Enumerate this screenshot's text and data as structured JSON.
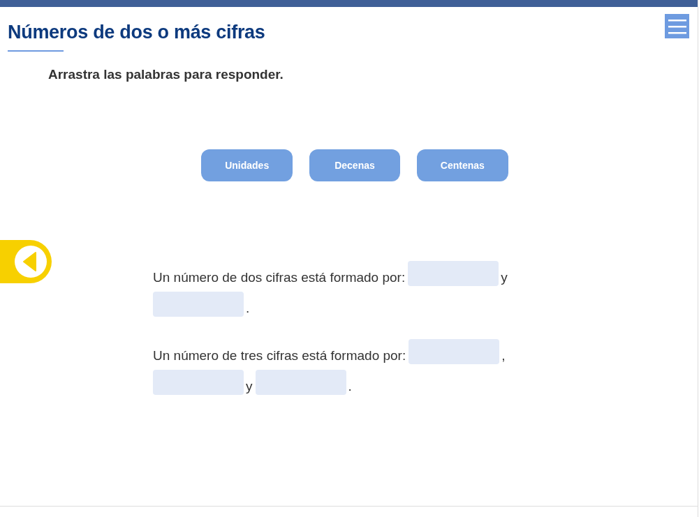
{
  "title": "Números de dos o más cifras",
  "instruction": "Arrastra las palabras para responder.",
  "words": [
    "Unidades",
    "Decenas",
    "Centenas"
  ],
  "sentences": [
    {
      "parts": [
        {
          "kind": "text",
          "text": "Un número de dos cifras está formado por:"
        },
        {
          "kind": "blank"
        },
        {
          "kind": "text",
          "text": "y"
        },
        {
          "kind": "blank"
        },
        {
          "kind": "text",
          "text": "."
        }
      ]
    },
    {
      "parts": [
        {
          "kind": "text",
          "text": "Un número de tres cifras está formado por:"
        },
        {
          "kind": "blank"
        },
        {
          "kind": "text",
          "text": ","
        },
        {
          "kind": "blank"
        },
        {
          "kind": "text",
          "text": "y"
        },
        {
          "kind": "blank"
        },
        {
          "kind": "text",
          "text": "."
        }
      ]
    }
  ]
}
